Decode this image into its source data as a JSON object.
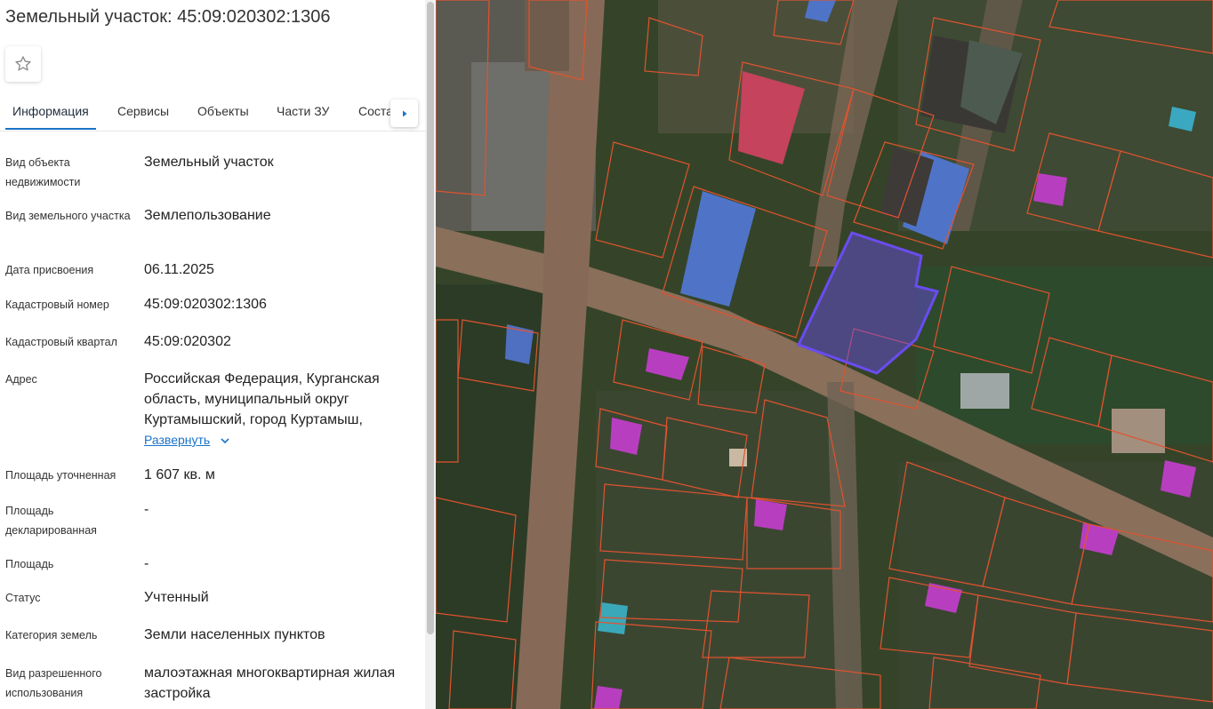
{
  "title": "Земельный участок: 45:09:020302:1306",
  "tabs": [
    {
      "label": "Информация"
    },
    {
      "label": "Сервисы"
    },
    {
      "label": "Объекты"
    },
    {
      "label": "Части ЗУ"
    },
    {
      "label": "Состав"
    }
  ],
  "rows": {
    "object_type": {
      "label": "Вид объекта недвижимости",
      "value": "Земельный участок"
    },
    "plot_type": {
      "label": "Вид земельного участка",
      "value": "Землепользование"
    },
    "assign_date": {
      "label": "Дата присвоения",
      "value": "06.11.2025"
    },
    "cad_number": {
      "label": "Кадастровый номер",
      "value": "45:09:020302:1306"
    },
    "cad_quarter": {
      "label": "Кадастровый квартал",
      "value": "45:09:020302"
    },
    "address": {
      "label": "Адрес",
      "value": "Российская Федерация, Курганская область, муниципальный округ Куртамышский, город Куртамыш,"
    },
    "area_refined": {
      "label": "Площадь уточненная",
      "value": "1 607 кв. м"
    },
    "area_declared": {
      "label": "Площадь декларированная",
      "value": "-"
    },
    "area": {
      "label": "Площадь",
      "value": "-"
    },
    "status": {
      "label": "Статус",
      "value": "Учтенный"
    },
    "land_category": {
      "label": "Категория земель",
      "value": "Земли населенных пунктов"
    },
    "permitted_use": {
      "label": "Вид разрешенного использования",
      "value": "малоэтажная многоквартирная жилая застройка"
    }
  },
  "expand_label": "Развернуть",
  "icons": {
    "favorite": "star-icon",
    "next": "chevron-right-icon",
    "expand": "chevron-down-icon"
  },
  "colors": {
    "accent": "#1a73c8",
    "parcel_border": "#e0532f",
    "selected_parcel": "#6a4cf0",
    "purple_roof": "#c23cc4"
  }
}
